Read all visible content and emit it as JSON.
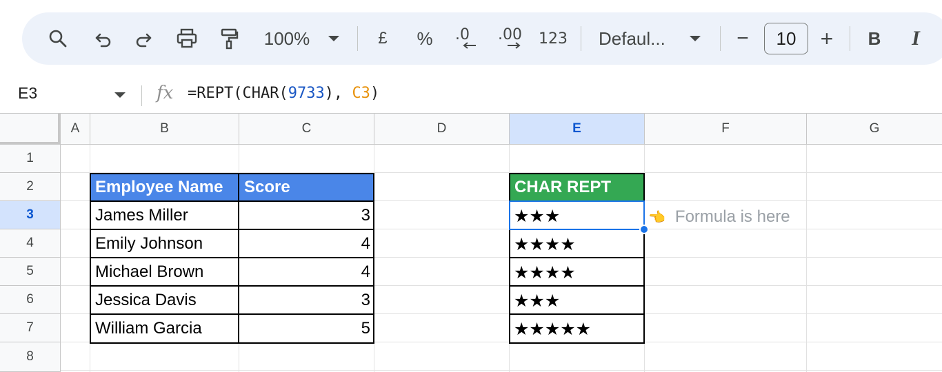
{
  "toolbar": {
    "zoom": "100%",
    "currency": "£",
    "percent": "%",
    "decrease_decimal": ".0",
    "increase_decimal": ".00",
    "number_format": "123",
    "font": "Defaul...",
    "font_size": "10",
    "bold": "B",
    "italic": "I",
    "minus": "−",
    "plus": "+"
  },
  "formula_bar": {
    "cell_ref": "E3",
    "fx": "fx",
    "formula_prefix": "=REPT(CHAR(",
    "formula_num": "9733",
    "formula_mid": "), ",
    "formula_ref": "C3",
    "formula_suffix": ")"
  },
  "columns": [
    "A",
    "B",
    "C",
    "D",
    "E",
    "F",
    "G"
  ],
  "rows": [
    "1",
    "2",
    "3",
    "4",
    "5",
    "6",
    "7",
    "8"
  ],
  "selected": {
    "column": "E",
    "row": "3"
  },
  "table": {
    "headers": {
      "name": "Employee Name",
      "score": "Score",
      "stars": "CHAR REPT"
    },
    "records": [
      {
        "name": "James Miller",
        "score": "3",
        "stars": "★★★"
      },
      {
        "name": "Emily Johnson",
        "score": "4",
        "stars": "★★★★"
      },
      {
        "name": "Michael Brown",
        "score": "4",
        "stars": "★★★★"
      },
      {
        "name": "Jessica Davis",
        "score": "3",
        "stars": "★★★"
      },
      {
        "name": "William Garcia",
        "score": "5",
        "stars": "★★★★★"
      }
    ]
  },
  "note": {
    "hand": "👈",
    "text": "Formula is here"
  },
  "colors": {
    "header_blue": "#4a86e8",
    "header_green": "#34a853",
    "selection": "#1a73e8",
    "formula_number": "#1a57c4",
    "formula_ref": "#e8920c"
  }
}
